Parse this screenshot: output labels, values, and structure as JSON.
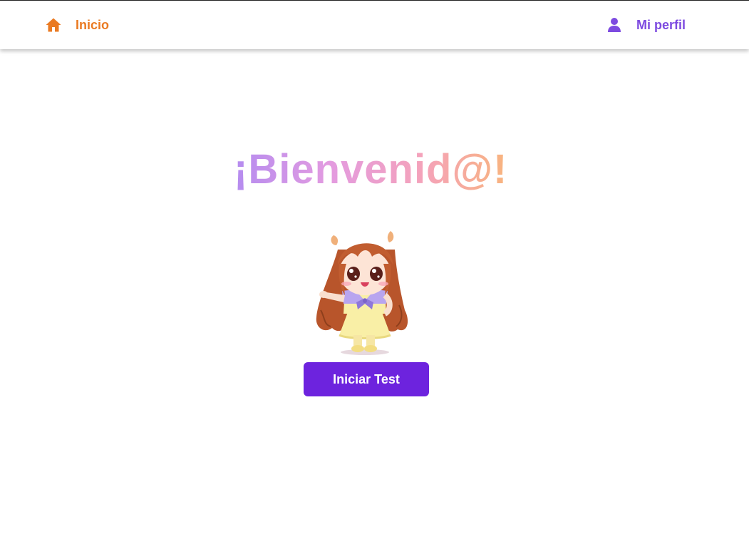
{
  "nav": {
    "home": {
      "label": "Inicio",
      "icon": "home-icon",
      "color": "#ea7a22"
    },
    "profile": {
      "label": "Mi perfil",
      "icon": "user-icon",
      "color": "#7d4be0"
    }
  },
  "main": {
    "title": "¡Bienvenid@!",
    "title_gradient": [
      "#b58cf0",
      "#e39be0",
      "#f5a3b9",
      "#f8b47e"
    ],
    "mascot": "chibi-girl-waving-illustration",
    "start_button": {
      "label": "Iniciar Test",
      "color": "#6d23de"
    }
  }
}
